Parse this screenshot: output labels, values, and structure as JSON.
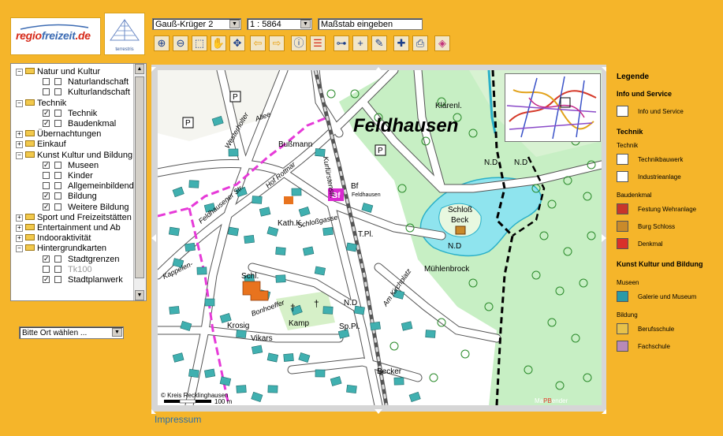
{
  "header": {
    "logo1_text_a": "regio",
    "logo1_text_b": "freizeit",
    "logo1_text_c": ".de",
    "logo2_text": "terrestris"
  },
  "controls": {
    "projection": "Gauß-Krüger 2",
    "scale": "1 : 5864",
    "scale_placeholder": "Maßstab eingeben"
  },
  "toolbar_icons": [
    "zoom-in-icon",
    "zoom-out-icon",
    "zoom-box-icon",
    "pan-hand-icon",
    "full-extent-icon",
    "back-arrow-icon",
    "forward-arrow-icon",
    "info-icon",
    "legend-icon",
    "measure-icon",
    "crosshair-icon",
    "pen-icon",
    "add-point-icon",
    "print-icon",
    "bookmark-icon"
  ],
  "tree": [
    {
      "level": 0,
      "type": "folder",
      "open": true,
      "label": "Natur und Kultur"
    },
    {
      "level": 1,
      "type": "item",
      "checked": false,
      "label": "Naturlandschaft"
    },
    {
      "level": 1,
      "type": "item",
      "checked": false,
      "label": "Kulturlandschaft"
    },
    {
      "level": 0,
      "type": "folder",
      "open": true,
      "label": "Technik"
    },
    {
      "level": 1,
      "type": "item",
      "checked": true,
      "label": "Technik"
    },
    {
      "level": 1,
      "type": "item",
      "checked": true,
      "label": "Baudenkmal"
    },
    {
      "level": 0,
      "type": "folder",
      "open": false,
      "label": "Übernachtungen"
    },
    {
      "level": 0,
      "type": "folder",
      "open": false,
      "label": "Einkauf"
    },
    {
      "level": 0,
      "type": "folder",
      "open": true,
      "label": "Kunst Kultur und Bildung"
    },
    {
      "level": 1,
      "type": "item",
      "checked": true,
      "label": "Museen"
    },
    {
      "level": 1,
      "type": "item",
      "checked": false,
      "label": "Kinder"
    },
    {
      "level": 1,
      "type": "item",
      "checked": false,
      "label": "Allgemeinbildende"
    },
    {
      "level": 1,
      "type": "item",
      "checked": true,
      "label": "Bildung"
    },
    {
      "level": 1,
      "type": "item",
      "checked": true,
      "label": "Weitere Bildung"
    },
    {
      "level": 0,
      "type": "folder",
      "open": false,
      "label": "Sport und Freizeitstätten"
    },
    {
      "level": 0,
      "type": "folder",
      "open": false,
      "label": "Entertainment und Ab"
    },
    {
      "level": 0,
      "type": "folder",
      "open": false,
      "label": "Indooraktivität"
    },
    {
      "level": 0,
      "type": "folder",
      "open": true,
      "label": "Hintergrundkarten"
    },
    {
      "level": 1,
      "type": "item",
      "checked": true,
      "label": "Stadtgrenzen"
    },
    {
      "level": 1,
      "type": "item",
      "checked": false,
      "label": "Tk100",
      "disabled": true
    },
    {
      "level": 1,
      "type": "item",
      "checked": true,
      "label": "Stadtplanwerk"
    }
  ],
  "ort_select": "Bitte Ort wählen ...",
  "map": {
    "place_big": "Feldhausen",
    "labels": [
      {
        "text": "Klärenl.",
        "kind": "small"
      },
      {
        "text": "Bußmann",
        "kind": "small"
      },
      {
        "text": "Bf",
        "kind": "small"
      },
      {
        "text": "Feldhausen",
        "kind": "tiny"
      },
      {
        "text": "Kath.K.",
        "kind": "small"
      },
      {
        "text": "Schloßgasse",
        "kind": "street"
      },
      {
        "text": "Schloß",
        "kind": "small"
      },
      {
        "text": "Beck",
        "kind": "small"
      },
      {
        "text": "N.D",
        "kind": "small"
      },
      {
        "text": "T.Pl.",
        "kind": "small"
      },
      {
        "text": "Mühlenbrock",
        "kind": "small"
      },
      {
        "text": "Sp.Pl.",
        "kind": "small"
      },
      {
        "text": "Becker",
        "kind": "small"
      },
      {
        "text": "Kamp",
        "kind": "small"
      },
      {
        "text": "Vikars",
        "kind": "small"
      },
      {
        "text": "Krosig",
        "kind": "small"
      },
      {
        "text": "Schl.",
        "kind": "small"
      },
      {
        "text": "Westerholter",
        "kind": "street"
      },
      {
        "text": "Allee",
        "kind": "street"
      },
      {
        "text": "Feldhausener Str.",
        "kind": "street"
      },
      {
        "text": "Kurfürstenstr.",
        "kind": "street"
      },
      {
        "text": "Hof Rottnar",
        "kind": "street"
      },
      {
        "text": "Am Kirchplatz",
        "kind": "street"
      },
      {
        "text": "Kappelen-",
        "kind": "street"
      },
      {
        "text": "Bonhoeffer",
        "kind": "street"
      }
    ],
    "copyright": "© Kreis Recklinghausen",
    "scalebar": "100 m",
    "credit_a": "Ma",
    "credit_b": "PB",
    "credit_c": "ender",
    "bf_label": "Bf",
    "p_label": "P"
  },
  "legend": {
    "title": "Legende",
    "sections": [
      {
        "header": "Info und Service",
        "items": [
          {
            "label": "Info und Service",
            "icon": "info-icon",
            "color": "#ffffff"
          }
        ]
      },
      {
        "header": "Technik",
        "sub": "Technik",
        "items": [
          {
            "label": "Technikbauwerk",
            "icon": "technikbauwerk-icon",
            "color": "#ffffff"
          },
          {
            "label": "Industrieanlage",
            "icon": "industrieanlage-icon",
            "color": "#ffffff"
          }
        ]
      },
      {
        "sub": "Baudenkmal",
        "items": [
          {
            "label": "Festung Wehranlage",
            "icon": "festung-icon",
            "color": "#c8352a"
          },
          {
            "label": "Burg Schloss",
            "icon": "burg-icon",
            "color": "#c98a2a"
          },
          {
            "label": "Denkmal",
            "icon": "denkmal-icon",
            "color": "#d9302a"
          }
        ]
      },
      {
        "header": "Kunst Kultur und Bildung",
        "sub": "Museen",
        "items": [
          {
            "label": "Galerie und Museum",
            "icon": "museum-icon",
            "color": "#2a9aa8"
          }
        ]
      },
      {
        "sub": "Bildung",
        "items": [
          {
            "label": "Berufsschule",
            "icon": "berufsschule-icon",
            "color": "#e8c24a"
          },
          {
            "label": "Fachschule",
            "icon": "fachschule-icon",
            "color": "#b88ab8"
          }
        ]
      }
    ]
  },
  "footer": {
    "impressum": "Impressum"
  },
  "colors": {
    "background": "#f5b52a",
    "map_green": "#c7efc4",
    "map_bldg": "#40b0b0",
    "water": "#8fe4ee",
    "boundary": "#e63ad8",
    "accent_red": "#d9452a"
  }
}
